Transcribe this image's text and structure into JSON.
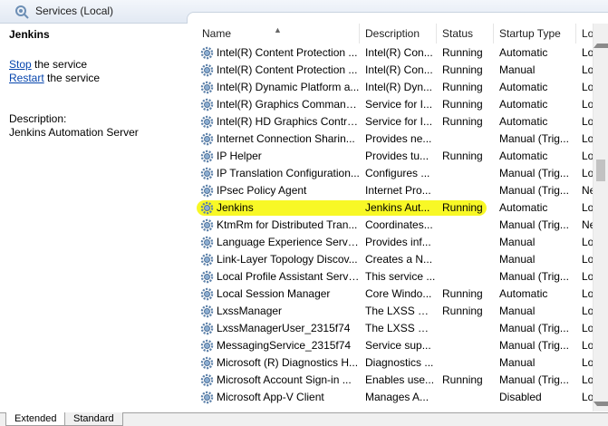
{
  "window": {
    "title": "Services (Local)"
  },
  "left_pane": {
    "service_name": "Jenkins",
    "actions": [
      {
        "link": "Stop",
        "rest": " the service"
      },
      {
        "link": "Restart",
        "rest": " the service"
      }
    ],
    "description_label": "Description:",
    "description": "Jenkins Automation Server"
  },
  "columns": [
    "Name",
    "Description",
    "Status",
    "Startup Type",
    "Log"
  ],
  "services": [
    {
      "name": "Intel(R) Content Protection ...",
      "description": "Intel(R) Con...",
      "status": "Running",
      "startup": "Automatic",
      "logon": "Lo"
    },
    {
      "name": "Intel(R) Content Protection ...",
      "description": "Intel(R) Con...",
      "status": "Running",
      "startup": "Manual",
      "logon": "Lo"
    },
    {
      "name": "Intel(R) Dynamic Platform a...",
      "description": "Intel(R) Dyn...",
      "status": "Running",
      "startup": "Automatic",
      "logon": "Lo"
    },
    {
      "name": "Intel(R) Graphics Command...",
      "description": "Service for I...",
      "status": "Running",
      "startup": "Automatic",
      "logon": "Lo"
    },
    {
      "name": "Intel(R) HD Graphics Contro...",
      "description": "Service for I...",
      "status": "Running",
      "startup": "Automatic",
      "logon": "Lo"
    },
    {
      "name": "Internet Connection Sharin...",
      "description": "Provides ne...",
      "status": "",
      "startup": "Manual (Trig...",
      "logon": "Lo"
    },
    {
      "name": "IP Helper",
      "description": "Provides tu...",
      "status": "Running",
      "startup": "Automatic",
      "logon": "Lo"
    },
    {
      "name": "IP Translation Configuration...",
      "description": "Configures ...",
      "status": "",
      "startup": "Manual (Trig...",
      "logon": "Lo"
    },
    {
      "name": "IPsec Policy Agent",
      "description": "Internet Pro...",
      "status": "",
      "startup": "Manual (Trig...",
      "logon": "Ne"
    },
    {
      "name": "Jenkins",
      "description": "Jenkins Aut...",
      "status": "Running",
      "startup": "Automatic",
      "logon": "Lo",
      "highlighted": true
    },
    {
      "name": "KtmRm for Distributed Tran...",
      "description": "Coordinates...",
      "status": "",
      "startup": "Manual (Trig...",
      "logon": "Ne"
    },
    {
      "name": "Language Experience Service",
      "description": "Provides inf...",
      "status": "",
      "startup": "Manual",
      "logon": "Lo"
    },
    {
      "name": "Link-Layer Topology Discov...",
      "description": "Creates a N...",
      "status": "",
      "startup": "Manual",
      "logon": "Lo"
    },
    {
      "name": "Local Profile Assistant Service",
      "description": "This service ...",
      "status": "",
      "startup": "Manual (Trig...",
      "logon": "Lo"
    },
    {
      "name": "Local Session Manager",
      "description": "Core Windo...",
      "status": "Running",
      "startup": "Automatic",
      "logon": "Lo"
    },
    {
      "name": "LxssManager",
      "description": "The LXSS M...",
      "status": "Running",
      "startup": "Manual",
      "logon": "Lo"
    },
    {
      "name": "LxssManagerUser_2315f74",
      "description": "The LXSS M...",
      "status": "",
      "startup": "Manual (Trig...",
      "logon": "Lo"
    },
    {
      "name": "MessagingService_2315f74",
      "description": "Service sup...",
      "status": "",
      "startup": "Manual (Trig...",
      "logon": "Lo"
    },
    {
      "name": "Microsoft (R) Diagnostics H...",
      "description": "Diagnostics ...",
      "status": "",
      "startup": "Manual",
      "logon": "Lo"
    },
    {
      "name": "Microsoft Account Sign-in ...",
      "description": "Enables use...",
      "status": "Running",
      "startup": "Manual (Trig...",
      "logon": "Lo"
    },
    {
      "name": "Microsoft App-V Client",
      "description": "Manages A...",
      "status": "",
      "startup": "Disabled",
      "logon": "Lo"
    }
  ],
  "tabs": [
    "Extended",
    "Standard"
  ],
  "scrollbar": {
    "position_fraction": 0.36,
    "visible_fraction": 0.06
  },
  "colors": {
    "highlight": "#f7f700",
    "link": "#0645ad",
    "gear": "#5a7fa8"
  },
  "icons": {
    "title": "services-gear-icon",
    "row": "service-gear-icon"
  }
}
